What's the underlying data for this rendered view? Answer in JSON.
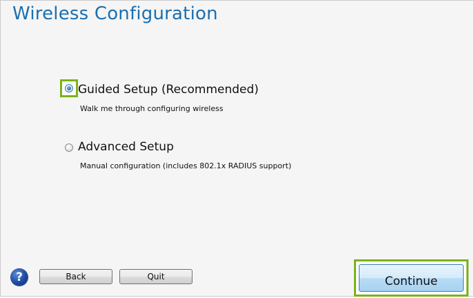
{
  "window": {
    "title": "Wireless Configuration"
  },
  "options": [
    {
      "label": "Guided Setup (Recommended)",
      "description": "Walk me through configuring wireless",
      "selected": true
    },
    {
      "label": "Advanced Setup",
      "description": "Manual configuration (includes 802.1x RADIUS support)",
      "selected": false
    }
  ],
  "footer": {
    "help_icon": "question-mark-icon",
    "help_glyph": "?",
    "back_label": "Back",
    "quit_label": "Quit",
    "continue_label": "Continue"
  },
  "colors": {
    "title": "#1b6fb0",
    "highlight": "#7ab317",
    "accent": "#3c7fb1"
  }
}
